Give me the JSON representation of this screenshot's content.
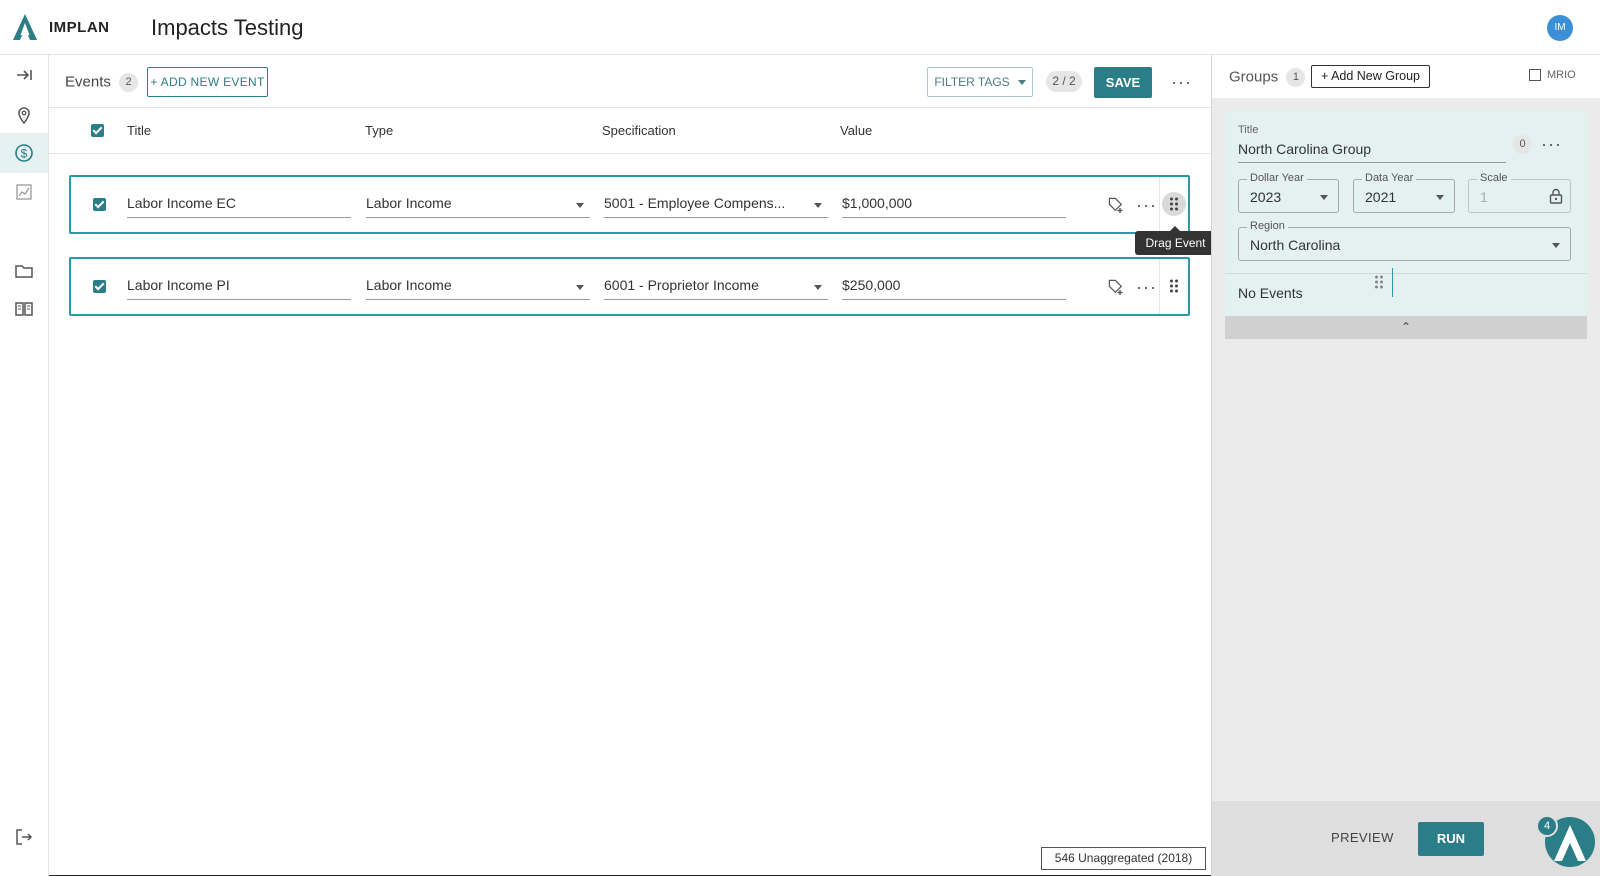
{
  "header": {
    "brand": "IMPLAN",
    "title": "Impacts Testing",
    "avatar_initials": "IM",
    "accent_color": "#2b7d87"
  },
  "rail": {
    "items": [
      {
        "name": "expand",
        "icon": "arrow-right-bar-icon"
      },
      {
        "name": "region",
        "icon": "map-pin-icon"
      },
      {
        "name": "impacts",
        "icon": "dollar-circle-icon",
        "active": true
      },
      {
        "name": "results",
        "icon": "chart-icon"
      },
      {
        "name": "projects",
        "icon": "folder-icon"
      },
      {
        "name": "docs",
        "icon": "book-icon"
      },
      {
        "name": "logout",
        "icon": "logout-icon"
      }
    ]
  },
  "events": {
    "label": "Events",
    "count": "2",
    "add_label": "+ ADD NEW EVENT",
    "filter_label": "FILTER TAGS",
    "pager": "2 / 2",
    "save_label": "SAVE",
    "columns": {
      "title": "Title",
      "type": "Type",
      "specification": "Specification",
      "value": "Value"
    },
    "rows": [
      {
        "title": "Labor Income EC",
        "type": "Labor Income",
        "specification": "5001 - Employee Compens...",
        "value": "$1,000,000"
      },
      {
        "title": "Labor Income PI",
        "type": "Labor Income",
        "specification": "6001 - Proprietor Income",
        "value": "$250,000"
      }
    ],
    "tooltip": "Drag Event",
    "footer_tag": "546 Unaggregated (2018)"
  },
  "groups": {
    "label": "Groups",
    "count": "1",
    "add_label": "+ Add New Group",
    "mrio_label": "MRIO",
    "card": {
      "title_label": "Title",
      "title_value": "North Carolina Group",
      "count": "0",
      "dollar_year_label": "Dollar Year",
      "dollar_year": "2023",
      "data_year_label": "Data Year",
      "data_year": "2021",
      "scale_label": "Scale",
      "scale": "1",
      "region_label": "Region",
      "region": "North Carolina",
      "no_events": "No Events"
    },
    "preview_label": "PREVIEW",
    "run_label": "RUN",
    "fab_badge": "4"
  }
}
